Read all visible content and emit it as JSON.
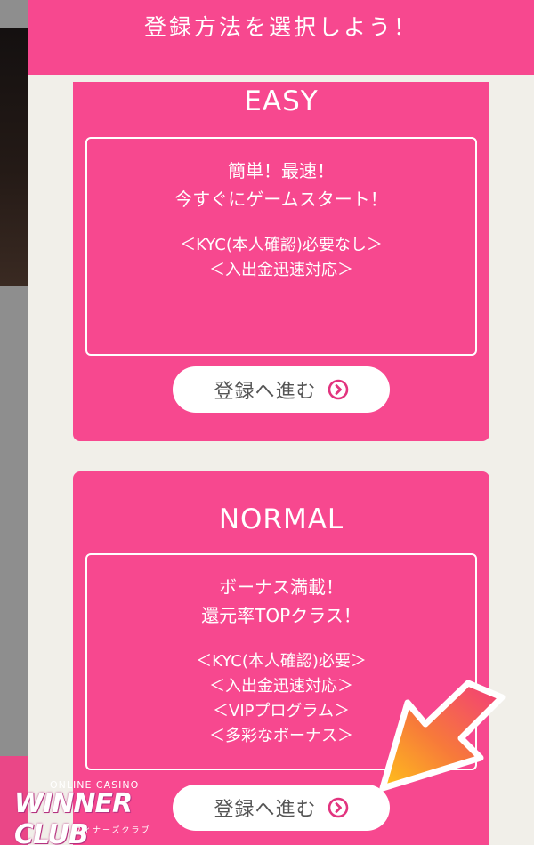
{
  "header": {
    "title": "登録方法を選択しよう！"
  },
  "plans": [
    {
      "title": "EASY",
      "lines": [
        "簡単！最速！",
        "今すぐにゲームスタート！"
      ],
      "notes": [
        "＜KYC(本人確認)必要なし＞",
        "＜入出金迅速対応＞"
      ],
      "button_label": "登録へ進む"
    },
    {
      "title": "NORMAL",
      "lines": [
        "ボーナス満載！",
        "還元率TOPクラス！"
      ],
      "notes": [
        "＜KYC(本人確認)必要＞",
        "＜入出金迅速対応＞",
        "＜VIPプログラム＞",
        "＜多彩なボーナス＞"
      ],
      "button_label": "登録へ進む"
    }
  ],
  "logo": {
    "top_text": "ONLINE CASINO",
    "main_text": "WINNER CLUB",
    "sub_text": "ウィナーズクラブ"
  },
  "colors": {
    "brand_pink": "#f7488f",
    "panel_bg": "#f1efe9",
    "button_text": "#555555"
  },
  "icons": {
    "button_icon": "chevron-right-circle-icon",
    "overlay": "pointer-arrow-icon"
  }
}
